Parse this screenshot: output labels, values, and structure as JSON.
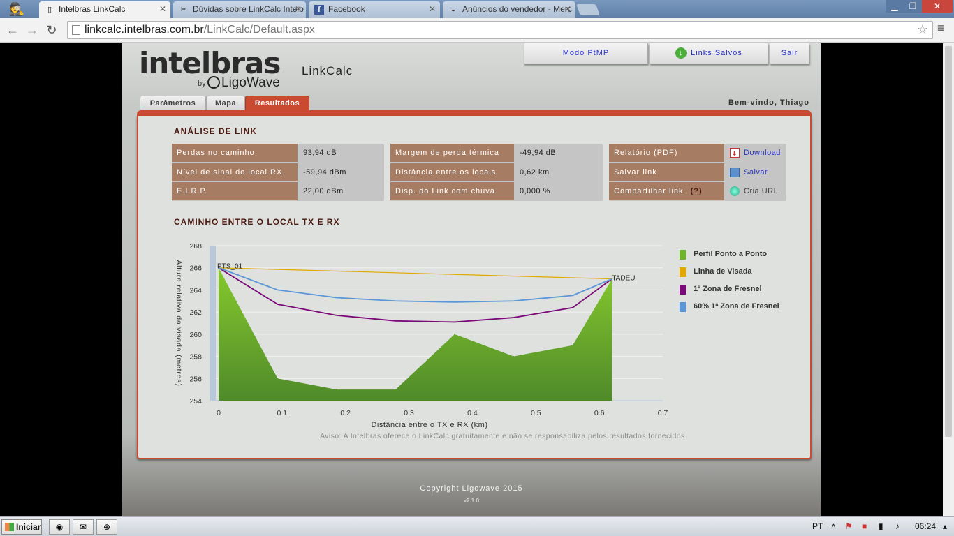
{
  "browser": {
    "tabs": [
      {
        "title": "Intelbras LinkCalc",
        "icon": "page-icon",
        "active": true
      },
      {
        "title": "Dúvidas sobre LinkCalc Intelb",
        "icon": "forum-icon",
        "active": false
      },
      {
        "title": "Facebook",
        "icon": "facebook-icon",
        "active": false
      },
      {
        "title": "Anúncios do vendedor - Merc",
        "icon": "mercadolivre-icon",
        "active": false
      }
    ],
    "url_host": "linkcalc.intelbras.com.br",
    "url_path": "/LinkCalc/Default.aspx"
  },
  "header": {
    "logo": "intelbras",
    "logo_by": "by",
    "logo_sub": "LigoWave",
    "app_name": "LinkCalc",
    "btn_ptmp": "Modo PtMP",
    "btn_saved": "Links Salvos",
    "btn_exit": "Sair",
    "welcome": "Bem-vindo, Thiago"
  },
  "nav": {
    "tabs": [
      "Parâmetros",
      "Mapa",
      "Resultados"
    ],
    "active": "Resultados"
  },
  "analysis": {
    "title": "ANÁLISE DE LINK",
    "col1": [
      {
        "label": "Perdas no caminho",
        "value": "93,94 dB"
      },
      {
        "label": "Nível de sinal do local RX",
        "value": "-59,94 dBm"
      },
      {
        "label": "E.I.R.P.",
        "value": "22,00 dBm"
      }
    ],
    "col2": [
      {
        "label": "Margem de perda térmica",
        "value": "-49,94 dB"
      },
      {
        "label": "Distância entre os locais",
        "value": "0,62 km"
      },
      {
        "label": "Disp. do Link com chuva",
        "value": "0,000 %"
      }
    ],
    "col3": [
      {
        "label": "Relatório (PDF)",
        "value": "Download",
        "icon": "pdf-icon"
      },
      {
        "label": "Salvar link",
        "value": "Salvar",
        "icon": "save-icon"
      },
      {
        "label": "Compartilhar link",
        "help": "(?)",
        "value": "Cria URL",
        "icon": "globe-icon"
      }
    ]
  },
  "path_section": {
    "title": "CAMINHO ENTRE O LOCAL TX E RX",
    "disclaimer": "Aviso: A Intelbras oferece o LinkCalc gratuitamente e não se responsabiliza pelos resultados fornecidos."
  },
  "chart_data": {
    "type": "area",
    "xlabel": "Distância entre o TX e RX (km)",
    "ylabel": "Altura relativa da visada (metros)",
    "xlim": [
      0,
      0.7
    ],
    "ylim": [
      254,
      268
    ],
    "xticks": [
      "0",
      "0.1",
      "0.2",
      "0.3",
      "0.4",
      "0.5",
      "0.6",
      "0.7"
    ],
    "yticks": [
      "254",
      "256",
      "258",
      "260",
      "262",
      "264",
      "266",
      "268"
    ],
    "grid": true,
    "legend_position": "right",
    "point_labels": [
      {
        "text": "PTS_01",
        "x": 0,
        "y": 266
      },
      {
        "text": "TADEU",
        "x": 0.62,
        "y": 265
      }
    ],
    "series": [
      {
        "name": "Perfil Ponto a Ponto",
        "color": "#6fb42a",
        "x": [
          0,
          0.093,
          0.186,
          0.279,
          0.372,
          0.465,
          0.558,
          0.62
        ],
        "y": [
          266,
          256,
          255,
          255,
          260,
          258,
          259,
          265
        ]
      },
      {
        "name": "Linha de Visada",
        "color": "#e0a800",
        "x": [
          0,
          0.62
        ],
        "y": [
          266,
          265
        ]
      },
      {
        "name": "1ª Zona de Fresnel",
        "color": "#7a0a78",
        "x": [
          0,
          0.093,
          0.186,
          0.279,
          0.372,
          0.465,
          0.558,
          0.62
        ],
        "y": [
          266,
          262.7,
          261.7,
          261.2,
          261.1,
          261.5,
          262.4,
          265
        ]
      },
      {
        "name": "60% 1ª Zona de Fresnel",
        "color": "#5b96d8",
        "x": [
          0,
          0.093,
          0.186,
          0.279,
          0.372,
          0.465,
          0.558,
          0.62
        ],
        "y": [
          266,
          264,
          263.3,
          263,
          262.9,
          263,
          263.5,
          265
        ]
      }
    ]
  },
  "footer": {
    "copyright": "Copyright Ligowave 2015",
    "version": "v2.1.0"
  },
  "taskbar": {
    "start": "Iniciar",
    "lang": "PT",
    "time": "06:24"
  }
}
